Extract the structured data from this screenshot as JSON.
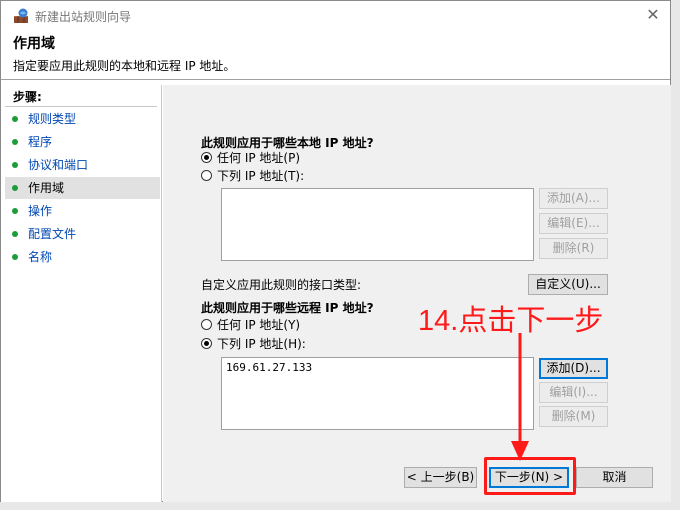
{
  "window": {
    "title": "新建出站规则向导",
    "close_glyph": "✕",
    "icon": "firewall-app-icon"
  },
  "header": {
    "title": "作用域",
    "description": "指定要应用此规则的本地和远程 IP 地址。"
  },
  "steps": {
    "label": "步骤:",
    "items": [
      {
        "label": "规则类型",
        "current": false
      },
      {
        "label": "程序",
        "current": false
      },
      {
        "label": "协议和端口",
        "current": false
      },
      {
        "label": "作用域",
        "current": true
      },
      {
        "label": "操作",
        "current": false
      },
      {
        "label": "配置文件",
        "current": false
      },
      {
        "label": "名称",
        "current": false
      }
    ]
  },
  "local": {
    "heading": "此规则应用于哪些本地 IP 地址?",
    "radio_any": "任何 IP 地址(P)",
    "radio_list": "下列 IP 地址(T):",
    "selected": "any",
    "addresses": [],
    "add_label": "添加(A)...",
    "edit_label": "编辑(E)...",
    "remove_label": "删除(R)"
  },
  "interface": {
    "label": "自定义应用此规则的接口类型:",
    "button_label": "自定义(U)..."
  },
  "remote": {
    "heading": "此规则应用于哪些远程 IP 地址?",
    "radio_any": "任何 IP 地址(Y)",
    "radio_list": "下列 IP 地址(H):",
    "selected": "list",
    "addresses": [
      "169.61.27.133"
    ],
    "add_label": "添加(D)...",
    "edit_label": "编辑(I)...",
    "remove_label": "删除(M)"
  },
  "footer": {
    "back_label": "< 上一步(B)",
    "next_label": "下一步(N) >",
    "cancel_label": "取消"
  },
  "annotation": {
    "text": "14.点击下一步",
    "color": "#ff1a1a"
  }
}
